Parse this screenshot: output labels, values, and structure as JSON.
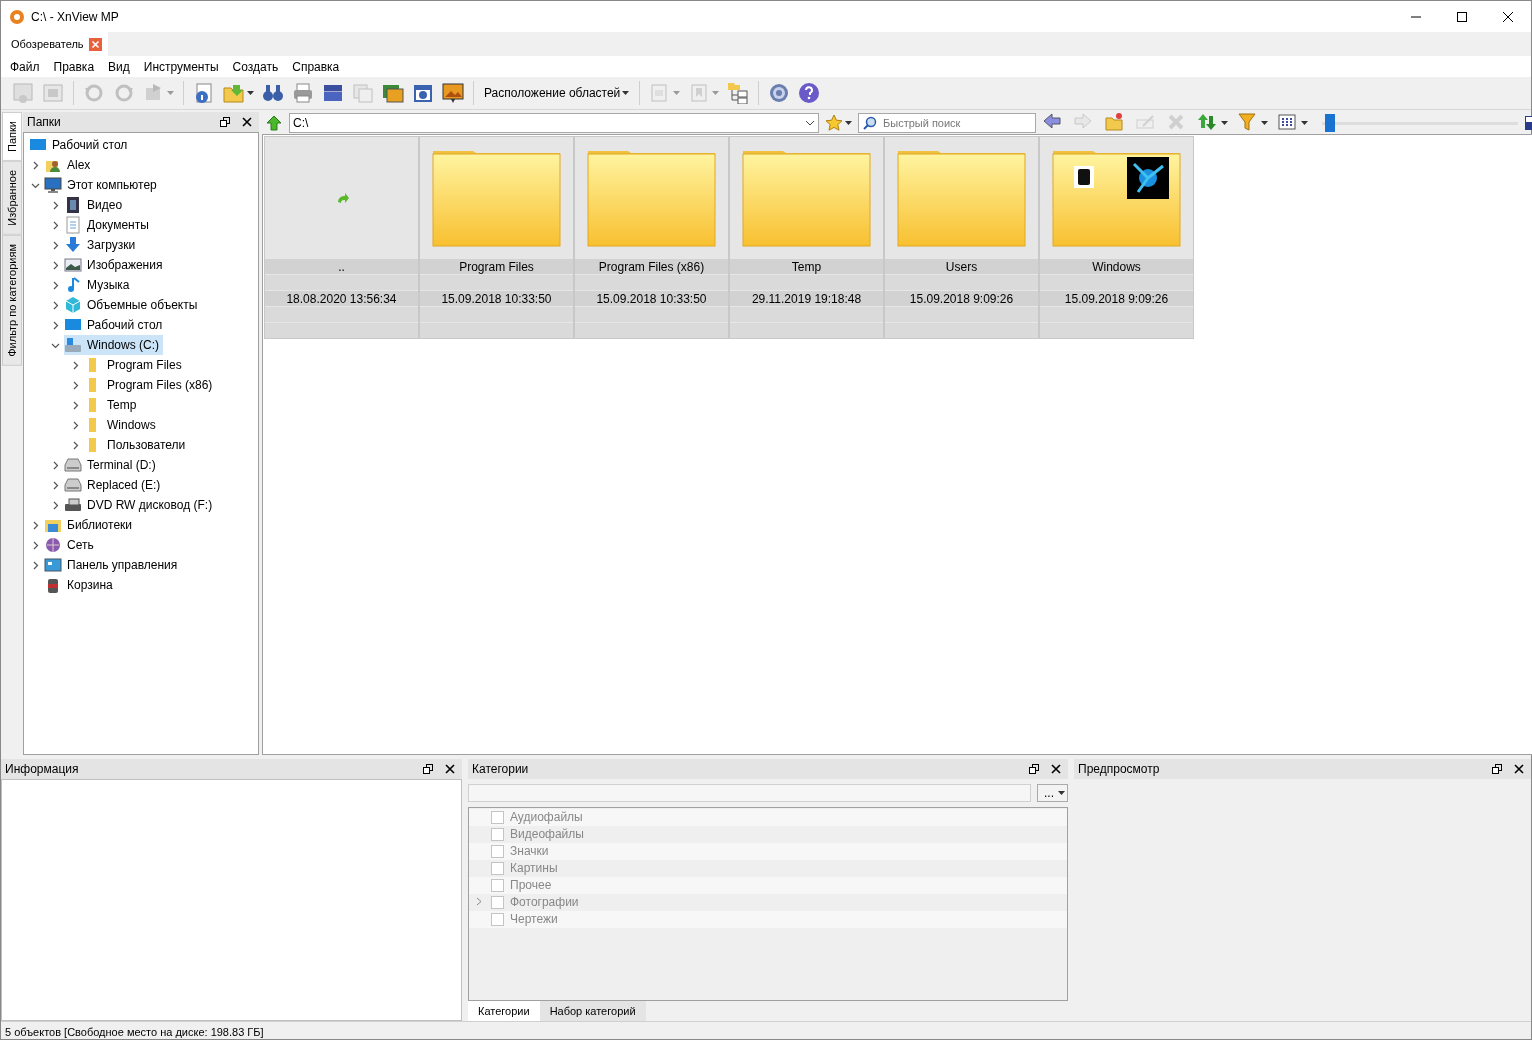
{
  "window": {
    "title": "C:\\ - XnView MP"
  },
  "doc_tabs": [
    {
      "label": "Обозреватель",
      "selected": true
    }
  ],
  "menu": [
    "Файл",
    "Правка",
    "Вид",
    "Инструменты",
    "Создать",
    "Справка"
  ],
  "toolbar": [
    {
      "kind": "view",
      "disabled": true,
      "dropdown": false
    },
    {
      "kind": "fullscreen",
      "disabled": true,
      "dropdown": false
    },
    {
      "kind": "separator"
    },
    {
      "kind": "rotate-left",
      "disabled": true,
      "dropdown": false
    },
    {
      "kind": "rotate-right",
      "disabled": true,
      "dropdown": false
    },
    {
      "kind": "transform",
      "disabled": true,
      "dropdown": true
    },
    {
      "kind": "separator"
    },
    {
      "kind": "info",
      "disabled": false,
      "dropdown": false
    },
    {
      "kind": "export",
      "disabled": false,
      "dropdown": true
    },
    {
      "kind": "binoculars",
      "disabled": false,
      "dropdown": false
    },
    {
      "kind": "print",
      "disabled": false,
      "dropdown": false
    },
    {
      "kind": "scan",
      "disabled": false,
      "dropdown": false
    },
    {
      "kind": "convert",
      "disabled": true,
      "dropdown": false
    },
    {
      "kind": "slides",
      "disabled": false,
      "dropdown": false
    },
    {
      "kind": "camera",
      "disabled": false,
      "dropdown": false
    },
    {
      "kind": "slideshow",
      "disabled": false,
      "dropdown": false
    },
    {
      "kind": "separator"
    },
    {
      "kind": "menu",
      "label": "Расположение областей",
      "disabled": false,
      "dropdown": true
    },
    {
      "kind": "separator"
    },
    {
      "kind": "pages",
      "disabled": true,
      "dropdown": true
    },
    {
      "kind": "tag",
      "disabled": true,
      "dropdown": true
    },
    {
      "kind": "folder-tree",
      "disabled": false,
      "dropdown": false
    },
    {
      "kind": "separator"
    },
    {
      "kind": "settings",
      "disabled": false,
      "dropdown": false
    },
    {
      "kind": "help",
      "disabled": false,
      "dropdown": false
    }
  ],
  "side_tabs": [
    {
      "label": "Папки",
      "selected": true
    },
    {
      "label": "Избранное",
      "selected": false
    },
    {
      "label": "Фильтр по категориям",
      "selected": false
    }
  ],
  "folders_panel": {
    "title": "Папки",
    "tree": [
      {
        "label": "Рабочий стол",
        "kind": "desktop",
        "selected": false,
        "children": [
          {
            "label": "Alex",
            "kind": "user",
            "selected": false,
            "expanded": false
          },
          {
            "label": "Этот компьютер",
            "kind": "computer",
            "selected": false,
            "expanded": true,
            "children": [
              {
                "label": "Видео",
                "kind": "video",
                "selected": false,
                "expanded": false
              },
              {
                "label": "Документы",
                "kind": "documents",
                "selected": false,
                "expanded": false
              },
              {
                "label": "Загрузки",
                "kind": "downloads",
                "selected": false,
                "expanded": false
              },
              {
                "label": "Изображения",
                "kind": "pictures",
                "selected": false,
                "expanded": false
              },
              {
                "label": "Музыка",
                "kind": "music",
                "selected": false,
                "expanded": false
              },
              {
                "label": "Объемные объекты",
                "kind": "cube",
                "selected": false,
                "expanded": false
              },
              {
                "label": "Рабочий стол",
                "kind": "desktop",
                "selected": false,
                "expanded": false
              },
              {
                "label": "Windows (C:)",
                "kind": "system-drive",
                "selected": true,
                "expanded": true,
                "children": [
                  {
                    "label": "Program Files",
                    "kind": "folder",
                    "selected": false,
                    "expanded": false
                  },
                  {
                    "label": "Program Files (x86)",
                    "kind": "folder",
                    "selected": false,
                    "expanded": false
                  },
                  {
                    "label": "Temp",
                    "kind": "folder",
                    "selected": false,
                    "expanded": false
                  },
                  {
                    "label": "Windows",
                    "kind": "folder",
                    "selected": false,
                    "expanded": false
                  },
                  {
                    "label": "Пользователи",
                    "kind": "folder",
                    "selected": false,
                    "expanded": false
                  }
                ]
              },
              {
                "label": "Terminal (D:)",
                "kind": "drive",
                "selected": false,
                "expanded": false
              },
              {
                "label": "Replaced (E:)",
                "kind": "drive",
                "selected": false,
                "expanded": false
              },
              {
                "label": "DVD RW дисковод (F:)",
                "kind": "dvd",
                "selected": false,
                "expanded": false
              }
            ]
          },
          {
            "label": "Библиотеки",
            "kind": "libraries",
            "selected": false,
            "expanded": false
          },
          {
            "label": "Сеть",
            "kind": "network",
            "selected": false,
            "expanded": false
          },
          {
            "label": "Панель управления",
            "kind": "control-panel",
            "selected": false,
            "expanded": false
          },
          {
            "label": "Корзина",
            "kind": "trash",
            "selected": false
          }
        ]
      }
    ]
  },
  "address": {
    "value": "C:\\"
  },
  "search": {
    "placeholder": "Быстрый поиск"
  },
  "nav_tools": [
    {
      "kind": "back",
      "disabled": false,
      "dropdown": false
    },
    {
      "kind": "forward",
      "disabled": true,
      "dropdown": false
    },
    {
      "kind": "new-folder",
      "disabled": false,
      "dropdown": false
    },
    {
      "kind": "rename",
      "disabled": true,
      "dropdown": false
    },
    {
      "kind": "delete",
      "disabled": true,
      "dropdown": false
    },
    {
      "kind": "refresh",
      "disabled": false,
      "dropdown": true
    },
    {
      "kind": "filter",
      "disabled": false,
      "dropdown": true
    },
    {
      "kind": "grid",
      "disabled": false,
      "dropdown": true
    }
  ],
  "thumb_size": {
    "level": 0.04
  },
  "thumbnails": [
    {
      "kind": "parent",
      "name": "..",
      "date": "18.08.2020 13:56:34",
      "selected": false
    },
    {
      "kind": "folder",
      "name": "Program Files",
      "date": "15.09.2018 10:33:50",
      "selected": false
    },
    {
      "kind": "folder",
      "name": "Program Files (x86)",
      "date": "15.09.2018 10:33:50",
      "selected": false
    },
    {
      "kind": "folder",
      "name": "Temp",
      "date": "29.11.2019 19:18:48",
      "selected": false
    },
    {
      "kind": "folder",
      "name": "Users",
      "date": "15.09.2018 9:09:26",
      "selected": false
    },
    {
      "kind": "folder-preview",
      "name": "Windows",
      "date": "15.09.2018 9:09:26",
      "selected": false
    }
  ],
  "info_panel": {
    "title": "Информация"
  },
  "categories_panel": {
    "title": "Категории",
    "button": "...",
    "items": [
      {
        "label": "Аудиофайлы",
        "checked": false,
        "expandable": false
      },
      {
        "label": "Видеофайлы",
        "checked": false,
        "expandable": false
      },
      {
        "label": "Значки",
        "checked": false,
        "expandable": false
      },
      {
        "label": "Картины",
        "checked": false,
        "expandable": false
      },
      {
        "label": "Прочее",
        "checked": false,
        "expandable": false
      },
      {
        "label": "Фотографии",
        "checked": false,
        "expandable": true
      },
      {
        "label": "Чертежи",
        "checked": false,
        "expandable": false
      }
    ],
    "tabs": [
      {
        "label": "Категории",
        "selected": true
      },
      {
        "label": "Набор категорий",
        "selected": false
      }
    ]
  },
  "preview_panel": {
    "title": "Предпросмотр"
  },
  "status_bar": "5 объектов [Свободное место на диске: 198.83 ГБ]"
}
